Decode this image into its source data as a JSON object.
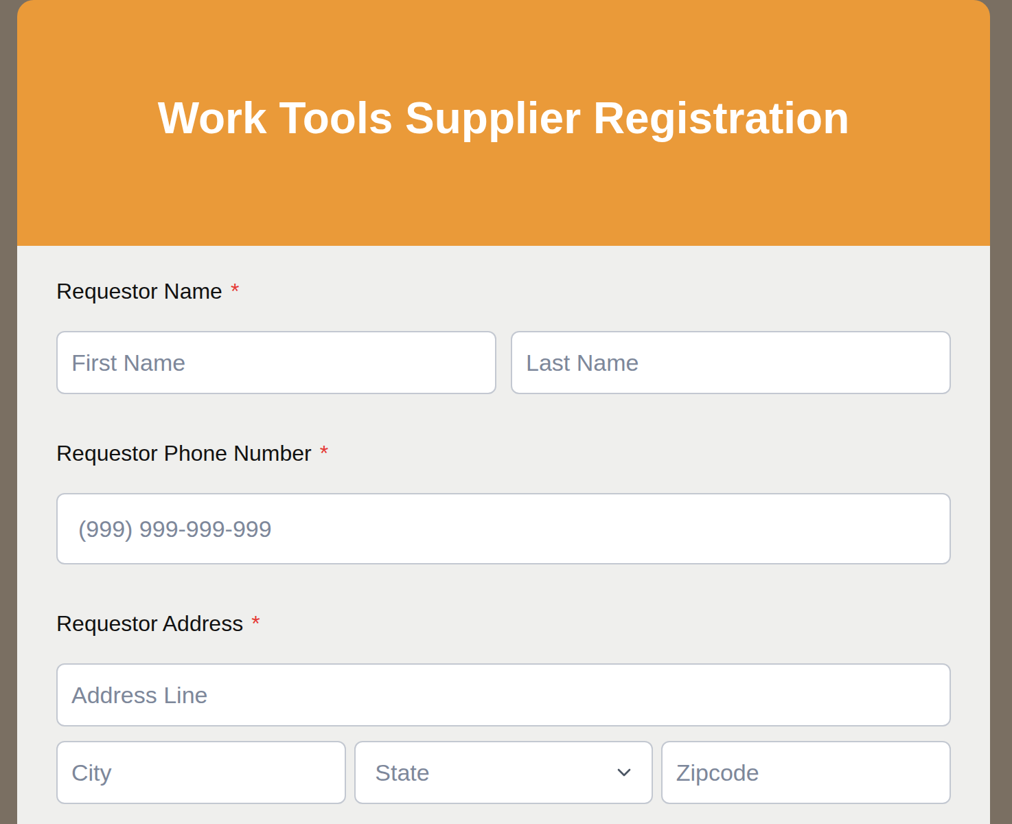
{
  "header": {
    "title": "Work Tools Supplier Registration"
  },
  "fields": [
    {
      "label": "Requestor Name",
      "required_mark": "*",
      "rows": [
        [
          {
            "placeholder": "First Name",
            "kind": "text"
          },
          {
            "placeholder": "Last Name",
            "kind": "text"
          }
        ]
      ]
    },
    {
      "label": "Requestor Phone Number",
      "required_mark": "*",
      "rows": [
        [
          {
            "placeholder": "(999) 999-999-999",
            "kind": "phone"
          }
        ]
      ]
    },
    {
      "label": "Requestor Address",
      "required_mark": "*",
      "rows": [
        [
          {
            "placeholder": "Address Line",
            "kind": "text"
          }
        ],
        [
          {
            "placeholder": "City",
            "kind": "text"
          },
          {
            "placeholder": "State",
            "kind": "select"
          },
          {
            "placeholder": "Zipcode",
            "kind": "text"
          }
        ]
      ]
    }
  ]
}
